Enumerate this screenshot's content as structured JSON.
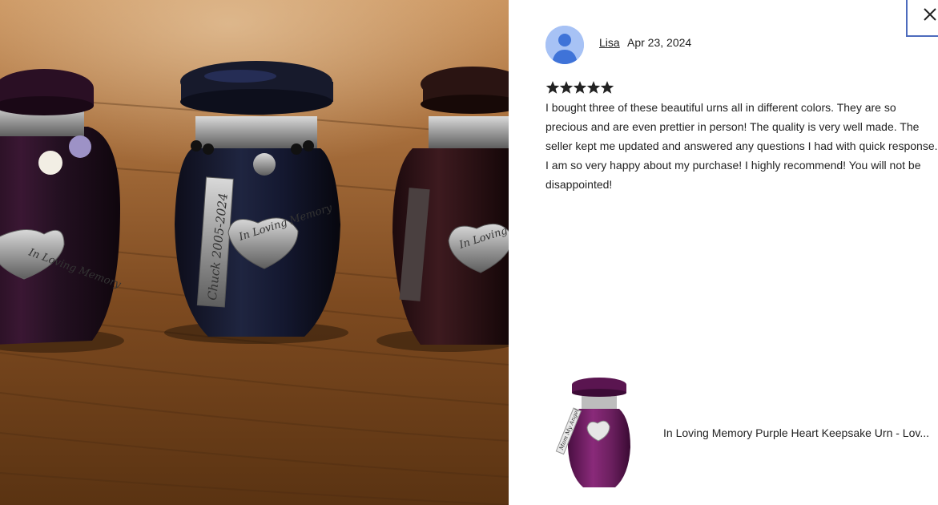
{
  "photo": {
    "alt_name": "review-photo-urns",
    "engravings": {
      "left_heart": "In Loving Memory",
      "center_heart": "In Loving Memory",
      "right_heart": "In Loving Memory",
      "center_tag": "Chuck 2005-2024"
    }
  },
  "review": {
    "reviewer_name": "Lisa",
    "date": "Apr 23, 2024",
    "rating": 5,
    "text": "I bought three of these beautiful urns all in different colors. They are so precious and are even prettier in person! The quality is very well made. The seller kept me updated and answered any questions I had with quick response. I am so very happy about my purchase! I highly recommend! You will not be disappointed!",
    "product_title": "In Loving Memory Purple Heart Keepsake Urn - Lov...",
    "thumb_tag": "Mom My Angel"
  },
  "colors": {
    "avatar_bg": "#a7c2f5",
    "avatar_fg": "#3f73d8",
    "star": "#222222",
    "close_border": "#4d6bbd",
    "urn_purple": "#6a1f5e",
    "wood": "#8a5a2b"
  },
  "icons": {
    "close": "close-icon",
    "avatar": "user-avatar-icon",
    "star": "star-icon"
  }
}
